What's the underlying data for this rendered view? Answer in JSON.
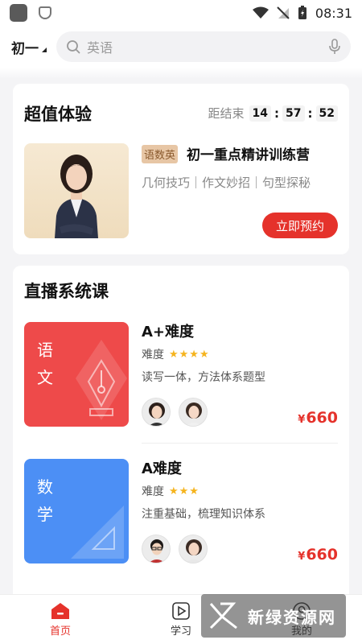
{
  "status_bar": {
    "time": "08:31"
  },
  "header": {
    "grade": "初一",
    "search_placeholder": "英语"
  },
  "promo": {
    "title": "超值体验",
    "countdown_label": "距结束",
    "hours": "14",
    "minutes": "57",
    "seconds": "52",
    "separator": ":",
    "tag": "语数英",
    "course_title": "初一重点精讲训练营",
    "course_sub": "几何技巧｜作文妙招｜句型探秘",
    "button": "立即预约"
  },
  "live": {
    "title": "直播系统课",
    "courses": [
      {
        "cover_text": "语文",
        "title": "A+难度",
        "difficulty_label": "难度",
        "stars": "★★★★",
        "desc": "读写一体，方法体系题型",
        "currency": "¥",
        "price": "660"
      },
      {
        "cover_text": "数学",
        "title": "A难度",
        "difficulty_label": "难度",
        "stars": "★★★",
        "desc": "注重基础，梳理知识体系",
        "currency": "¥",
        "price": "660"
      }
    ]
  },
  "nav": {
    "home": "首页",
    "study": "学习",
    "mine": "我的"
  },
  "watermark": {
    "text": "新绿资源网"
  },
  "colors": {
    "accent": "#e5322b",
    "chinese_cover": "#ee4a4a",
    "math_cover": "#4c8ff5",
    "star": "#f5b41e"
  }
}
